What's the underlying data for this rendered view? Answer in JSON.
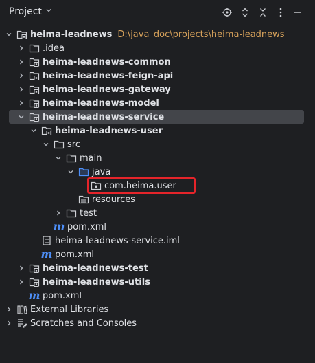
{
  "header": {
    "title": "Project"
  },
  "tree": [
    {
      "label": "heima-leadnews",
      "path": "D:\\java_doc\\projects\\heima-leadnews",
      "bold": true,
      "expanded": true,
      "icon": "module-folder-icon",
      "indent": 0
    },
    {
      "label": ".idea",
      "bold": false,
      "expanded": false,
      "icon": "folder-icon",
      "indent": 1
    },
    {
      "label": "heima-leadnews-common",
      "bold": true,
      "expanded": false,
      "icon": "module-folder-icon",
      "indent": 1
    },
    {
      "label": "heima-leadnews-feign-api",
      "bold": true,
      "expanded": false,
      "icon": "module-folder-icon",
      "indent": 1
    },
    {
      "label": "heima-leadnews-gateway",
      "bold": true,
      "expanded": false,
      "icon": "module-folder-icon",
      "indent": 1
    },
    {
      "label": "heima-leadnews-model",
      "bold": true,
      "expanded": false,
      "icon": "module-folder-icon",
      "indent": 1
    },
    {
      "label": "heima-leadnews-service",
      "bold": true,
      "expanded": true,
      "selected": true,
      "icon": "module-folder-icon",
      "indent": 1
    },
    {
      "label": "heima-leadnews-user",
      "bold": true,
      "expanded": true,
      "icon": "module-folder-icon",
      "indent": 2
    },
    {
      "label": "src",
      "bold": false,
      "expanded": true,
      "icon": "folder-icon",
      "indent": 3
    },
    {
      "label": "main",
      "bold": false,
      "expanded": true,
      "icon": "folder-icon",
      "indent": 4
    },
    {
      "label": "java",
      "bold": false,
      "expanded": true,
      "icon": "source-folder-icon",
      "indent": 5
    },
    {
      "label": "com.heima.user",
      "bold": false,
      "icon": "package-icon",
      "indent": 6,
      "leaf": true
    },
    {
      "label": "resources",
      "bold": false,
      "icon": "resources-folder-icon",
      "indent": 5,
      "leaf": true
    },
    {
      "label": "test",
      "bold": false,
      "expanded": false,
      "icon": "folder-icon",
      "indent": 4
    },
    {
      "label": "pom.xml",
      "bold": false,
      "icon": "maven-icon",
      "indent": 3,
      "leaf": true
    },
    {
      "label": "heima-leadnews-service.iml",
      "bold": false,
      "icon": "iml-file-icon",
      "indent": 2,
      "leaf": true
    },
    {
      "label": "pom.xml",
      "bold": false,
      "icon": "maven-icon",
      "indent": 2,
      "leaf": true
    },
    {
      "label": "heima-leadnews-test",
      "bold": true,
      "expanded": false,
      "icon": "module-folder-icon",
      "indent": 1
    },
    {
      "label": "heima-leadnews-utils",
      "bold": true,
      "expanded": false,
      "icon": "module-folder-icon",
      "indent": 1
    },
    {
      "label": "pom.xml",
      "bold": false,
      "icon": "maven-icon",
      "indent": 1,
      "leaf": true
    },
    {
      "label": "External Libraries",
      "bold": false,
      "expanded": false,
      "icon": "libraries-icon",
      "indent": 0
    },
    {
      "label": "Scratches and Consoles",
      "bold": false,
      "expanded": false,
      "icon": "scratches-icon",
      "indent": 0
    }
  ],
  "colors": {
    "background": "#1e1f22",
    "selection": "#43454a",
    "highlight": "#e5242a",
    "path": "#d5a05a",
    "maven": "#4d8ef7"
  }
}
